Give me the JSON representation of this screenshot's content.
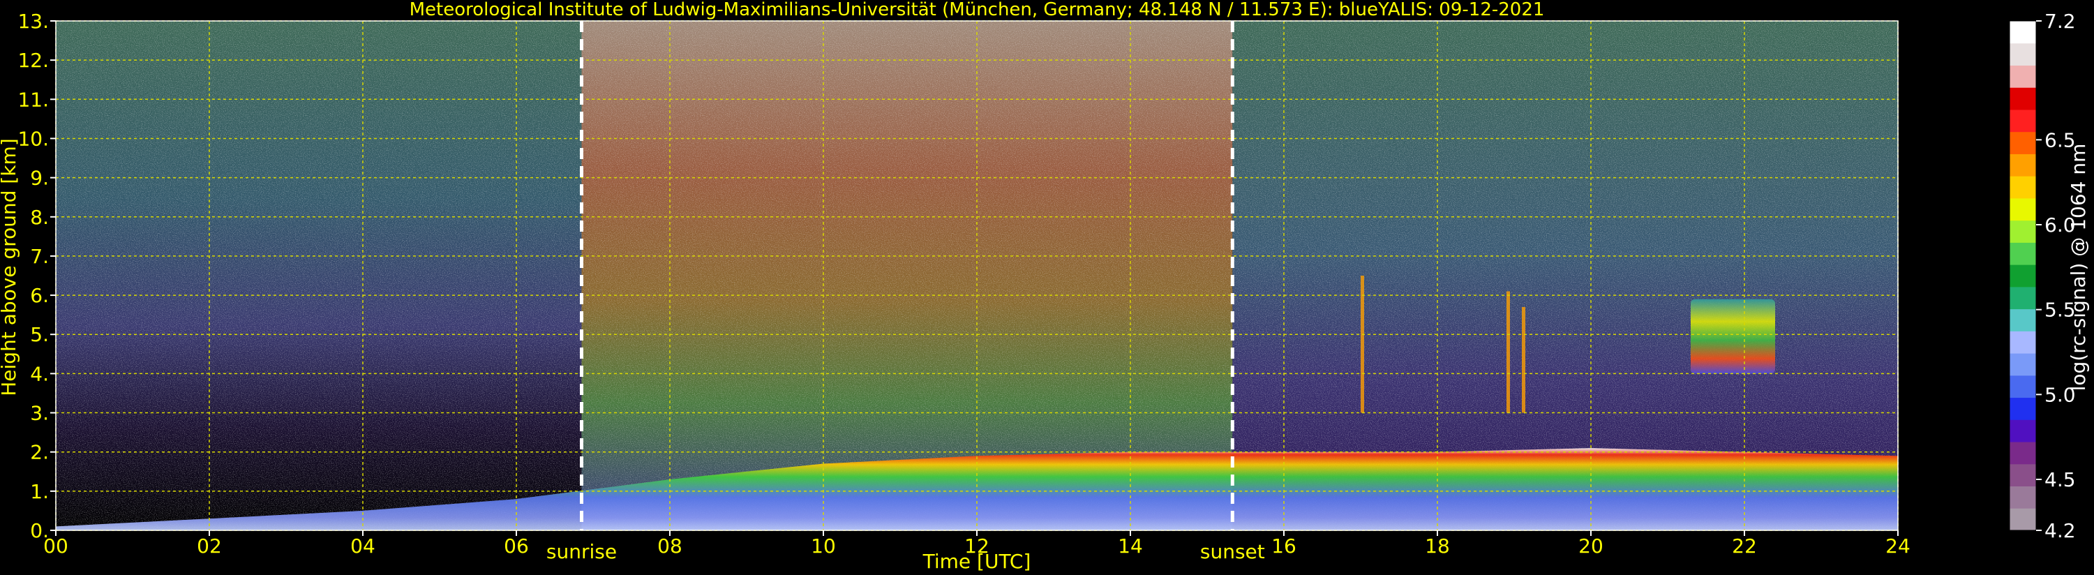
{
  "chart_data": {
    "type": "heatmap",
    "title": "Meteorological Institute of Ludwig-Maximilians-Universität (München, Germany; 48.148 N / 11.573 E):    blueYALIS: 09-12-2021",
    "xlabel": "Time [UTC]",
    "ylabel": "Height above ground [km]",
    "xlim": [
      0,
      24
    ],
    "ylim": [
      0,
      13
    ],
    "x_ticks": [
      "00",
      "02",
      "04",
      "06",
      "08",
      "10",
      "12",
      "14",
      "16",
      "18",
      "20",
      "22",
      "24"
    ],
    "x_tick_values": [
      0,
      2,
      4,
      6,
      8,
      10,
      12,
      14,
      16,
      18,
      20,
      22,
      24
    ],
    "y_ticks": [
      "0.",
      "1.",
      "2.",
      "3.",
      "4.",
      "5.",
      "6.",
      "7.",
      "8.",
      "9.",
      "10.",
      "11.",
      "12.",
      "13."
    ],
    "y_tick_values": [
      0,
      1,
      2,
      3,
      4,
      5,
      6,
      7,
      8,
      9,
      10,
      11,
      12,
      13
    ],
    "grid": true,
    "grid_color": "#d8d800",
    "text_color": "#ffff00",
    "annotations": [
      {
        "label": "sunrise",
        "x": 6.85
      },
      {
        "label": "sunset",
        "x": 15.33
      }
    ],
    "colorbar": {
      "label": "log(rc-signal) @ 1064 nm",
      "range": [
        4.2,
        7.2
      ],
      "tick_labels": [
        "4.2",
        "4.5",
        "5.0",
        "5.5",
        "6.0",
        "6.5",
        "7.2"
      ],
      "tick_values": [
        4.2,
        4.5,
        5.0,
        5.5,
        6.0,
        6.5,
        7.2
      ],
      "colors": [
        "#a89aa8",
        "#9a7a9a",
        "#8a4f8a",
        "#7a2a8a",
        "#5010c0",
        "#2030f0",
        "#4a6af0",
        "#7a9af8",
        "#a8b8ff",
        "#58c8c8",
        "#20b070",
        "#10a030",
        "#50d050",
        "#a0f030",
        "#e8f800",
        "#ffd000",
        "#ffa000",
        "#ff6000",
        "#ff2020",
        "#e00000",
        "#f0b0b0",
        "#e8e0e0",
        "#ffffff"
      ]
    },
    "features": [
      {
        "name": "boundary layer aerosol",
        "x": [
          0,
          24
        ],
        "y_top_km": [
          0.1,
          0.3,
          0.5,
          0.8,
          1.3,
          1.7,
          1.9,
          2.0,
          2.0,
          2.0,
          2.1,
          2.0,
          1.9
        ]
      },
      {
        "name": "elevated cloud layer",
        "x": [
          21.3,
          22.4
        ],
        "y_km": [
          4.0,
          5.9
        ]
      },
      {
        "name": "thin virga streaks",
        "x": [
          17.0,
          18.9
        ],
        "y_km": [
          3.0,
          6.5
        ]
      }
    ]
  }
}
